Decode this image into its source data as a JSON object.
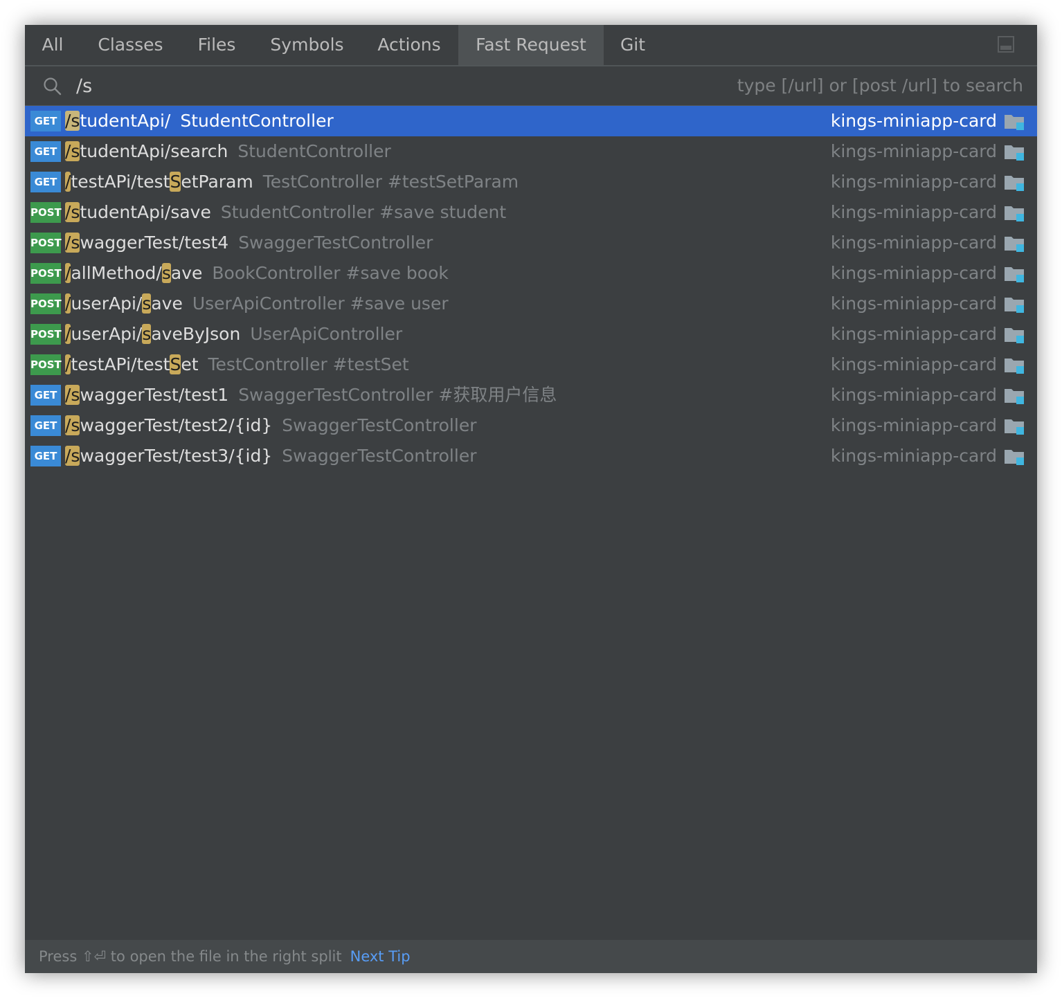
{
  "tabs": [
    {
      "label": "All"
    },
    {
      "label": "Classes"
    },
    {
      "label": "Files"
    },
    {
      "label": "Symbols"
    },
    {
      "label": "Actions"
    },
    {
      "label": "Fast Request",
      "selected": true
    },
    {
      "label": "Git"
    }
  ],
  "search": {
    "value": "/s",
    "hint": "type [/url] or [post /url] to search"
  },
  "results": [
    {
      "method": "GET",
      "parts": [
        {
          "t": "/s",
          "h": true
        },
        {
          "t": "tudentApi/"
        }
      ],
      "desc": "StudentController",
      "module": "kings-miniapp-card",
      "selected": true
    },
    {
      "method": "GET",
      "parts": [
        {
          "t": "/s",
          "h": true
        },
        {
          "t": "tudentApi/search"
        }
      ],
      "desc": "StudentController",
      "module": "kings-miniapp-card"
    },
    {
      "method": "GET",
      "parts": [
        {
          "t": "/",
          "h": true
        },
        {
          "t": "testAPi/test"
        },
        {
          "t": "S",
          "h": true
        },
        {
          "t": "etParam"
        }
      ],
      "desc": "TestController #testSetParam",
      "module": "kings-miniapp-card"
    },
    {
      "method": "POST",
      "parts": [
        {
          "t": "/s",
          "h": true
        },
        {
          "t": "tudentApi/save"
        }
      ],
      "desc": "StudentController #save student",
      "module": "kings-miniapp-card"
    },
    {
      "method": "POST",
      "parts": [
        {
          "t": "/s",
          "h": true
        },
        {
          "t": "waggerTest/test4"
        }
      ],
      "desc": "SwaggerTestController",
      "module": "kings-miniapp-card"
    },
    {
      "method": "POST",
      "parts": [
        {
          "t": "/",
          "h": true
        },
        {
          "t": "allMethod/"
        },
        {
          "t": "s",
          "h": true
        },
        {
          "t": "ave"
        }
      ],
      "desc": "BookController #save book",
      "module": "kings-miniapp-card"
    },
    {
      "method": "POST",
      "parts": [
        {
          "t": "/",
          "h": true
        },
        {
          "t": "userApi/"
        },
        {
          "t": "s",
          "h": true
        },
        {
          "t": "ave"
        }
      ],
      "desc": "UserApiController #save user",
      "module": "kings-miniapp-card"
    },
    {
      "method": "POST",
      "parts": [
        {
          "t": "/",
          "h": true
        },
        {
          "t": "userApi/"
        },
        {
          "t": "s",
          "h": true
        },
        {
          "t": "aveByJson"
        }
      ],
      "desc": "UserApiController",
      "module": "kings-miniapp-card"
    },
    {
      "method": "POST",
      "parts": [
        {
          "t": "/",
          "h": true
        },
        {
          "t": "testAPi/test"
        },
        {
          "t": "S",
          "h": true
        },
        {
          "t": "et"
        }
      ],
      "desc": "TestController #testSet",
      "module": "kings-miniapp-card"
    },
    {
      "method": "GET",
      "parts": [
        {
          "t": "/s",
          "h": true
        },
        {
          "t": "waggerTest/test1"
        }
      ],
      "desc": "SwaggerTestController #获取用户信息",
      "module": "kings-miniapp-card"
    },
    {
      "method": "GET",
      "parts": [
        {
          "t": "/s",
          "h": true
        },
        {
          "t": "waggerTest/test2/{id}"
        }
      ],
      "desc": "SwaggerTestController",
      "module": "kings-miniapp-card"
    },
    {
      "method": "GET",
      "parts": [
        {
          "t": "/s",
          "h": true
        },
        {
          "t": "waggerTest/test3/{id}"
        }
      ],
      "desc": "SwaggerTestController",
      "module": "kings-miniapp-card"
    }
  ],
  "footer": {
    "text": "Press ⇧⏎ to open the file in the right split",
    "link": "Next Tip"
  },
  "icons": {
    "search": "search-icon",
    "folder": "module-folder-icon",
    "layout": "layout-toggle-icon"
  },
  "colors": {
    "selection": "#2f65ca",
    "get_badge": "#3a8ad6",
    "post_badge": "#3d9a4d",
    "match_highlight": "#c8a95a",
    "link": "#589df6"
  }
}
